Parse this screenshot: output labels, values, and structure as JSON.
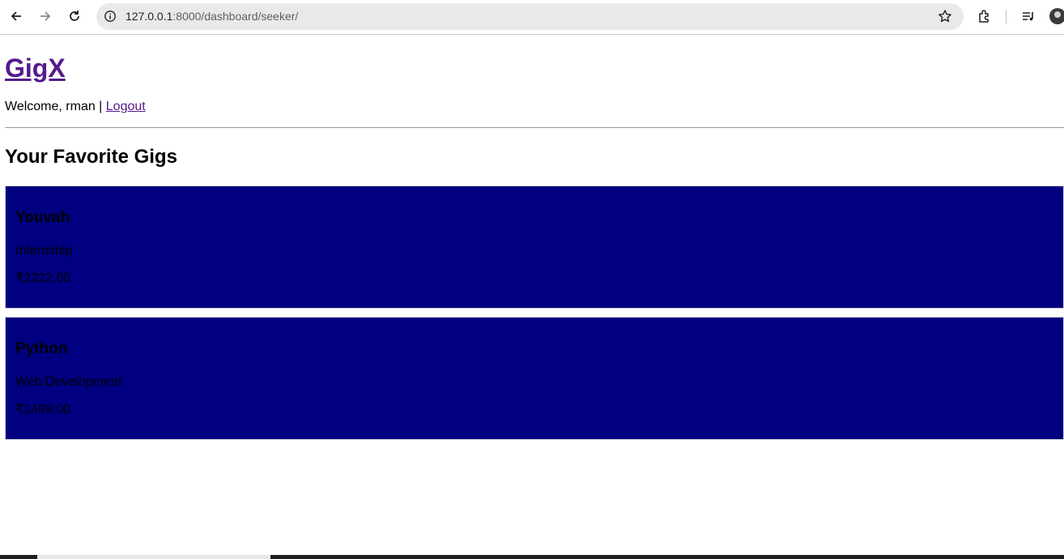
{
  "browser": {
    "url_host": "127.0.0.1",
    "url_rest": ":8000/dashboard/seeker/",
    "icons": [
      "back-icon",
      "forward-icon",
      "reload-icon",
      "info-icon",
      "star-icon",
      "extensions-icon",
      "media-icon",
      "avatar"
    ]
  },
  "header": {
    "site_title": "GigX",
    "welcome_prefix": "Welcome, rman | ",
    "logout_label": "Logout"
  },
  "main": {
    "section_title": "Your Favorite Gigs",
    "gigs": [
      {
        "title": "Youvah",
        "category": "Internship",
        "price": "₹2222.00"
      },
      {
        "title": "Python",
        "category": "Web Development",
        "price": "₹1499.00"
      }
    ]
  },
  "colors": {
    "card_bg": "#000080",
    "link": "#551a8b"
  }
}
